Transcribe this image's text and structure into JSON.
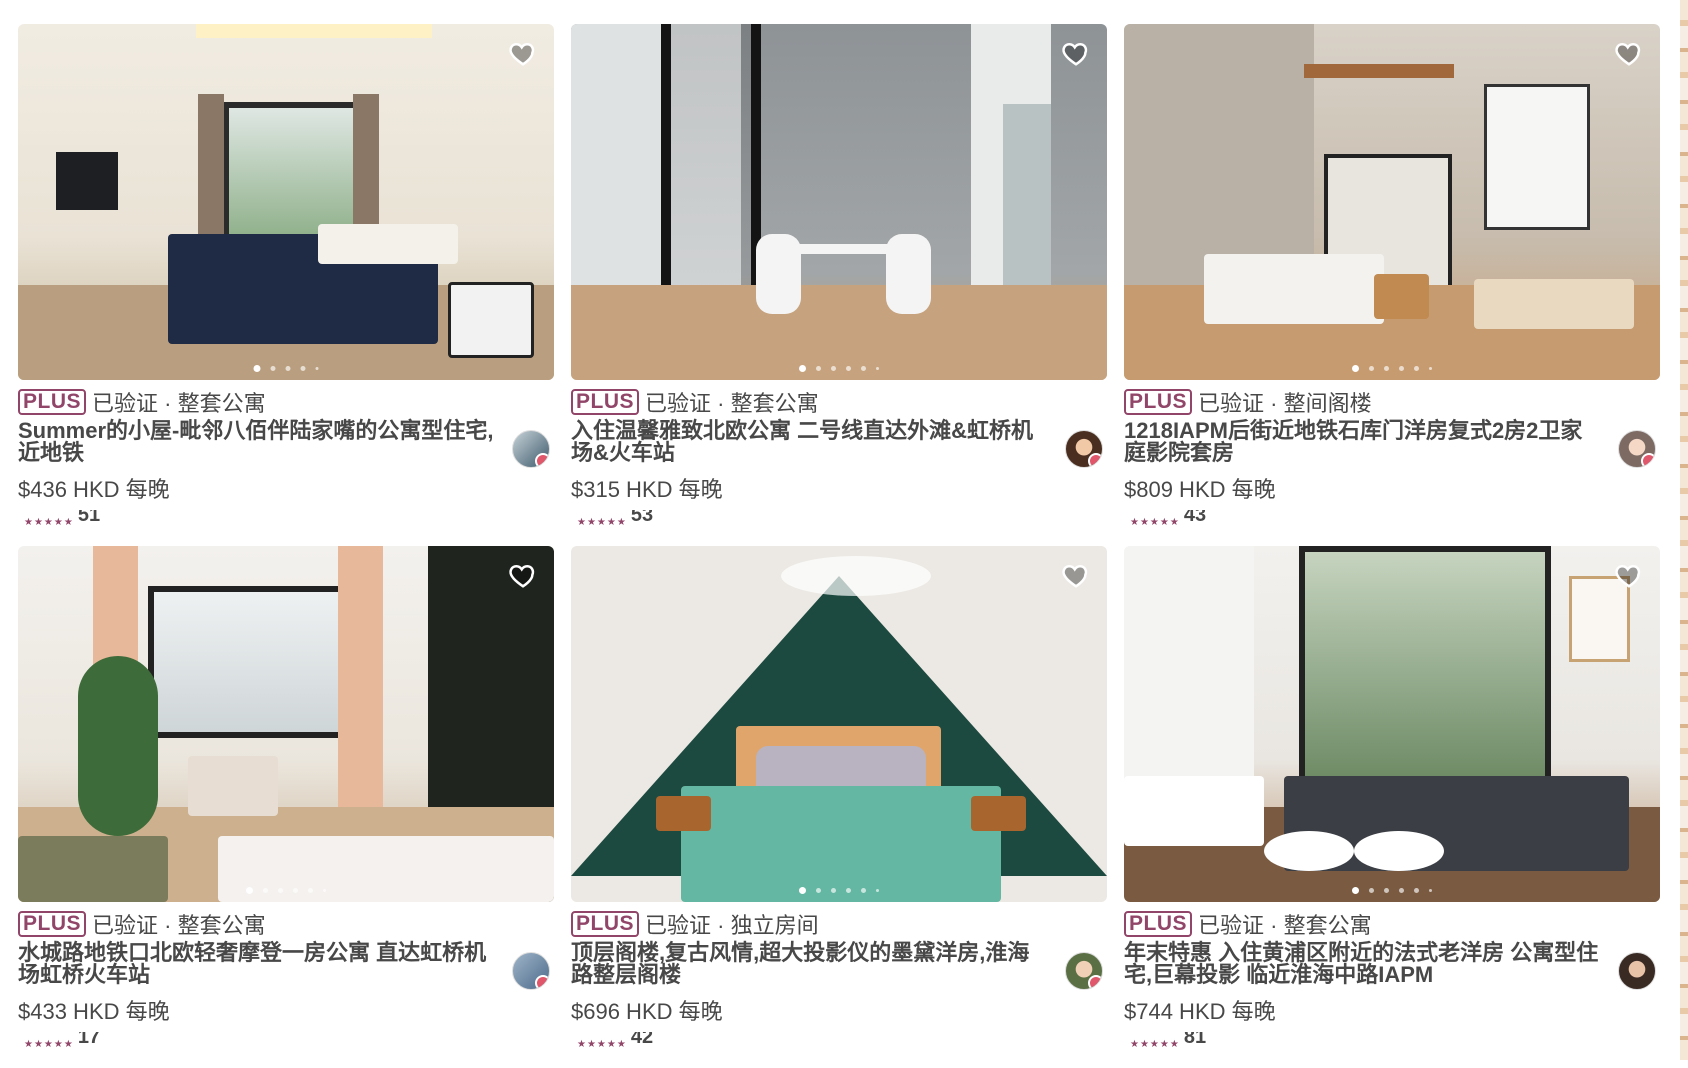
{
  "page": {
    "cut_text": ""
  },
  "colors": {
    "plus_accent": "#914669",
    "text": "#484848",
    "heart_stroke": "#ffffff"
  },
  "icons": {
    "favorite": "heart-icon",
    "rating": "star-icon"
  },
  "listings": [
    {
      "badge": "PLUS",
      "type": "已验证 · 整套公寓",
      "title": "Summer的小屋-毗邻八佰伴陆家嘴的公寓型住宅,近地铁",
      "price": "$436 HKD 每晚",
      "stars": "★★★★★",
      "reviews": "51",
      "carousel_count": 5,
      "carousel_active": 0
    },
    {
      "badge": "PLUS",
      "type": "已验证 · 整套公寓",
      "title": "入住温馨雅致北欧公寓 二号线直达外滩&虹桥机场&火车站",
      "price": "$315 HKD 每晚",
      "stars": "★★★★★",
      "reviews": "53",
      "carousel_count": 6,
      "carousel_active": 0
    },
    {
      "badge": "PLUS",
      "type": "已验证 · 整间阁楼",
      "title": "1218IAPM后街近地铁石库门洋房复式2房2卫家庭影院套房",
      "price": "$809 HKD 每晚",
      "stars": "★★★★★",
      "reviews": "43",
      "carousel_count": 6,
      "carousel_active": 0
    },
    {
      "badge": "PLUS",
      "type": "已验证 · 整套公寓",
      "title": "水城路地铁口北欧轻奢摩登一房公寓 直达虹桥机场虹桥火车站",
      "price": "$433 HKD 每晚",
      "stars": "★★★★★",
      "reviews": "17",
      "carousel_count": 6,
      "carousel_active": 0
    },
    {
      "badge": "PLUS",
      "type": "已验证 · 独立房间",
      "title": "顶层阁楼,复古风情,超大投影仪的墨黛洋房,淮海路整层阁楼",
      "price": "$696 HKD 每晚",
      "stars": "★★★★★",
      "reviews": "42",
      "carousel_count": 6,
      "carousel_active": 0
    },
    {
      "badge": "PLUS",
      "type": "已验证 · 整套公寓",
      "title": "年末特惠 入住黄浦区附近的法式老洋房 公寓型住宅,巨幕投影 临近淮海中路IAPM",
      "price": "$744 HKD 每晚",
      "stars": "★★★★★",
      "reviews": "81",
      "carousel_count": 6,
      "carousel_active": 0
    }
  ]
}
